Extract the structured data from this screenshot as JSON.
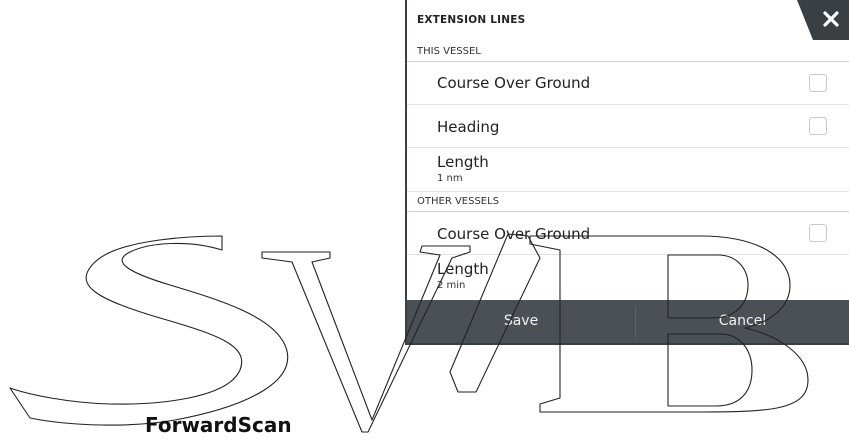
{
  "dialog": {
    "title": "EXTENSION LINES",
    "close_icon": "close-icon",
    "sections": [
      {
        "header": "THIS VESSEL",
        "rows": [
          {
            "label": "Course Over Ground",
            "type": "checkbox",
            "checked": false
          },
          {
            "label": "Heading",
            "type": "checkbox",
            "checked": false
          },
          {
            "label": "Length",
            "value": "1 nm",
            "type": "value"
          }
        ]
      },
      {
        "header": "OTHER VESSELS",
        "rows": [
          {
            "label": "Course Over Ground",
            "type": "checkbox",
            "checked": false
          },
          {
            "label": "Length",
            "value": "2 min",
            "type": "value"
          }
        ]
      }
    ],
    "buttons": {
      "save_label": "Save",
      "cancel_label": "Cancel"
    }
  },
  "watermark": "SVB",
  "caption": "ForwardScan",
  "colors": {
    "button_bar": "#4a5056",
    "close_tab": "#3a3f44",
    "section_divider": "#e8c8cf"
  }
}
